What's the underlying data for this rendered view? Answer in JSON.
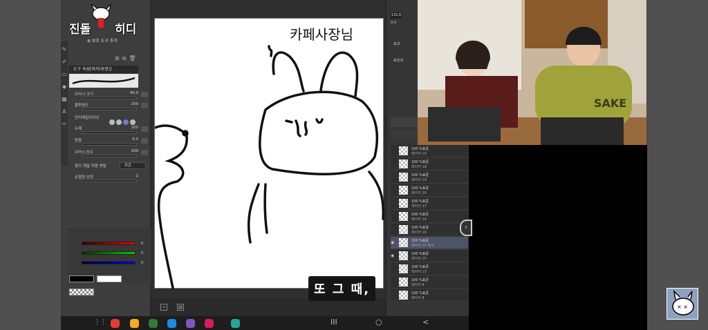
{
  "logo": {
    "text_left": "진돌",
    "text_right": "히디"
  },
  "subtool_label": "보조 도구 추가",
  "tool_property": {
    "header": "도구 속성[마커(투명)]",
    "props": [
      {
        "label": "브러시 크기",
        "value": "40.0"
      },
      {
        "label": "불투명도",
        "value": "100"
      },
      {
        "label": "안티에일리어싱",
        "value": ""
      },
      {
        "label": "두께",
        "value": "100"
      },
      {
        "label": "방향",
        "value": "0.0"
      },
      {
        "label": "브러시 농도",
        "value": "100"
      },
      {
        "label": "종이 재질 적용 방법",
        "value": "표준"
      },
      {
        "label": "손떨림 보정",
        "value": "2"
      }
    ]
  },
  "color_values": {
    "r": "0",
    "g": "0",
    "b": "0"
  },
  "canvas_text": "카페사장님",
  "right_panel": {
    "zoom": "131.6",
    "zoom2": "0.0",
    "label_effect": "효과",
    "label_expression": "표현색"
  },
  "layers": [
    {
      "opacity": "100 %표준",
      "name": "레이어 10"
    },
    {
      "opacity": "100 %표준",
      "name": "레이어 18"
    },
    {
      "opacity": "100 %표준",
      "name": "레이어 19"
    },
    {
      "opacity": "100 %표준",
      "name": "레이어 20"
    },
    {
      "opacity": "100 %표준",
      "name": "레이어 17"
    },
    {
      "opacity": "100 %표준",
      "name": "레이어 14"
    },
    {
      "opacity": "100 %표준",
      "name": "레이어 16"
    },
    {
      "opacity": "100 %표준",
      "name": "레이어 15 복사"
    },
    {
      "opacity": "100 %표준",
      "name": "레이어 15"
    },
    {
      "opacity": "100 %표준",
      "name": "레이어 13"
    },
    {
      "opacity": "100 %표준",
      "name": "레이어 9"
    },
    {
      "opacity": "100 %표준",
      "name": "레이어 8"
    }
  ],
  "subtitle": "또 그 때,",
  "video": {
    "shirt_text": "SAKE"
  },
  "nav": {
    "recents": "III",
    "home": "○",
    "back": "<"
  }
}
